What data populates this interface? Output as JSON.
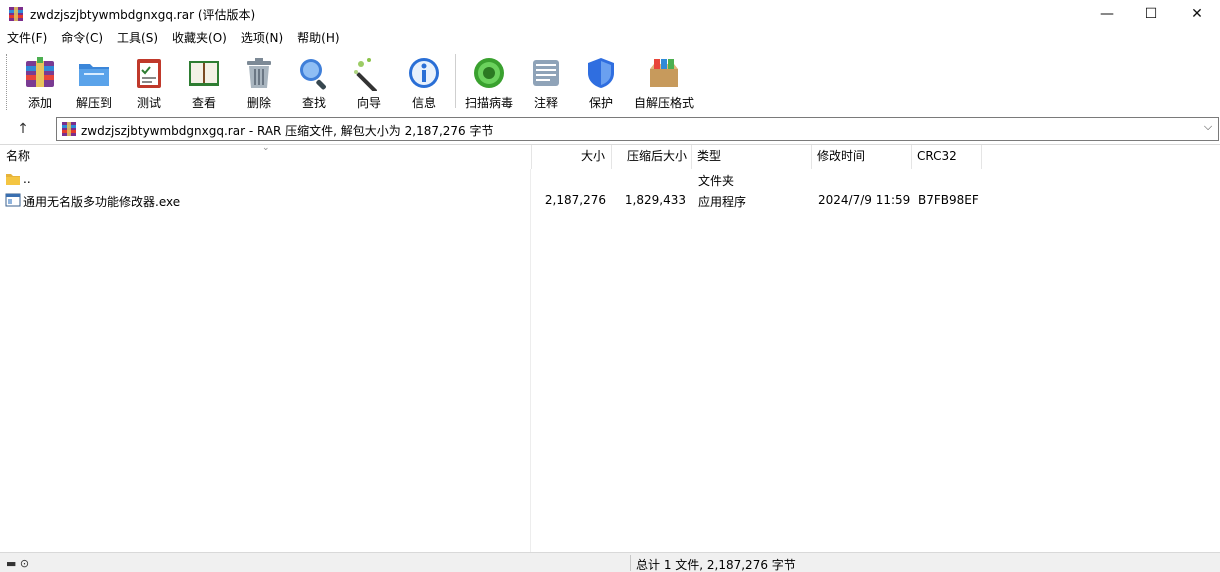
{
  "window": {
    "title": "zwdzjszjbtywmbdgnxgq.rar (评估版本)",
    "minimize_glyph": "—",
    "maximize_glyph": "☐",
    "close_glyph": "✕"
  },
  "menu": [
    {
      "label": "文件(F)"
    },
    {
      "label": "命令(C)"
    },
    {
      "label": "工具(S)"
    },
    {
      "label": "收藏夹(O)"
    },
    {
      "label": "选项(N)"
    },
    {
      "label": "帮助(H)"
    }
  ],
  "toolbar": [
    {
      "label": "添加",
      "icon": "add-archive-icon"
    },
    {
      "label": "解压到",
      "icon": "extract-folder-icon"
    },
    {
      "label": "测试",
      "icon": "test-clipboard-icon"
    },
    {
      "label": "查看",
      "icon": "view-book-icon"
    },
    {
      "label": "删除",
      "icon": "trash-icon"
    },
    {
      "label": "查找",
      "icon": "magnifier-icon"
    },
    {
      "label": "向导",
      "icon": "wizard-wand-icon"
    },
    {
      "label": "信息",
      "icon": "info-icon"
    },
    {
      "label": "扫描病毒",
      "icon": "virus-scan-icon"
    },
    {
      "label": "注释",
      "icon": "comment-icon"
    },
    {
      "label": "保护",
      "icon": "shield-icon"
    },
    {
      "label": "自解压格式",
      "icon": "sfx-box-icon"
    }
  ],
  "address": {
    "up_glyph": "↑",
    "text": "zwdzjszjbtywmbdgnxgq.rar - RAR 压缩文件, 解包大小为 2,187,276 字节",
    "dropdown_glyph": "⌵"
  },
  "columns": {
    "name": "名称",
    "size": "大小",
    "packed": "压缩后大小",
    "type": "类型",
    "modified": "修改时间",
    "crc": "CRC32",
    "sort_glyph": "⌄"
  },
  "rows": [
    {
      "name": "..",
      "size": "",
      "packed": "",
      "type": "文件夹",
      "modified": "",
      "crc": "",
      "icon": "folder-icon"
    },
    {
      "name": "通用无名版多功能修改器.exe",
      "size": "2,187,276",
      "packed": "1,829,433",
      "type": "应用程序",
      "modified": "2024/7/9 11:59",
      "crc": "B7FB98EF",
      "icon": "exe-file-icon"
    }
  ],
  "status": {
    "left_glyphs": "▬ ⊙",
    "summary": "总计 1 文件, 2,187,276 字节"
  },
  "colors": {
    "accent_blue": "#2a6fd6",
    "shield_blue": "#2f6ee0",
    "green_scan": "#3aa12f",
    "folder_yellow": "#f4c542"
  }
}
